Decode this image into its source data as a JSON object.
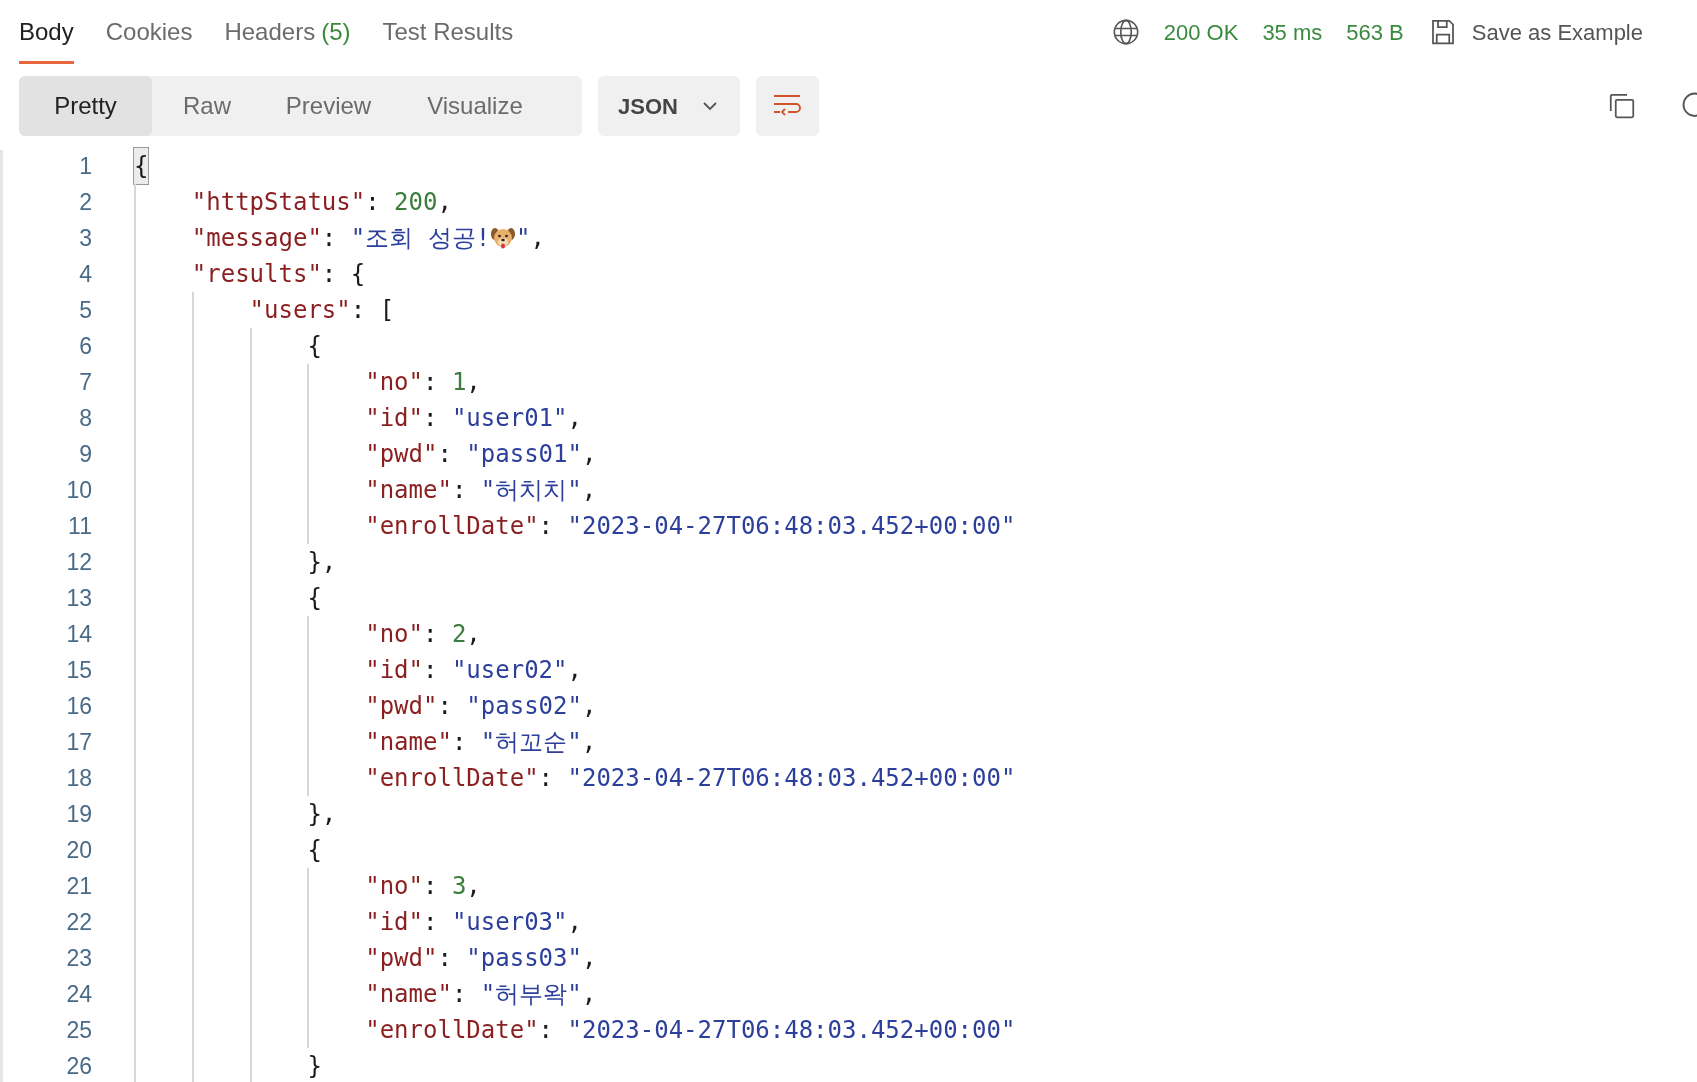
{
  "tabs": [
    {
      "label": "Body",
      "selected": true
    },
    {
      "label": "Cookies",
      "selected": false
    },
    {
      "label": "Headers",
      "count": "(5)",
      "selected": false
    },
    {
      "label": "Test Results",
      "selected": false
    }
  ],
  "response_meta": {
    "status": "200 OK",
    "time": "35 ms",
    "size": "563 B",
    "save_label": "Save as Example"
  },
  "view_modes": [
    {
      "label": "Pretty",
      "selected": true
    },
    {
      "label": "Raw",
      "selected": false
    },
    {
      "label": "Preview",
      "selected": false
    },
    {
      "label": "Visualize",
      "selected": false
    }
  ],
  "format_dropdown": {
    "value": "JSON"
  },
  "lines": [
    {
      "number": "1",
      "highlighted": true,
      "tokens": [
        {
          "kind": "punct",
          "text": "{"
        }
      ],
      "children": [
        {
          "number": "2",
          "highlighted": false,
          "tokens": [
            {
              "kind": "key",
              "text": "\"httpStatus\""
            },
            {
              "kind": "punct",
              "text": ": "
            },
            {
              "kind": "number",
              "text": "200"
            },
            {
              "kind": "punct",
              "text": ","
            }
          ]
        },
        {
          "number": "3",
          "highlighted": false,
          "tokens": [
            {
              "kind": "key",
              "text": "\"message\""
            },
            {
              "kind": "punct",
              "text": ": "
            },
            {
              "kind": "string",
              "text": "\"조회 성공!"
            },
            {
              "kind": "icon"
            },
            {
              "kind": "string",
              "text": "\""
            },
            {
              "kind": "punct",
              "text": ","
            }
          ]
        },
        {
          "number": "4",
          "highlighted": false,
          "tokens": [
            {
              "kind": "key",
              "text": "\"results\""
            },
            {
              "kind": "punct",
              "text": ": {"
            }
          ],
          "children": [
            {
              "number": "5",
              "highlighted": false,
              "tokens": [
                {
                  "kind": "key",
                  "text": "\"users\""
                },
                {
                  "kind": "punct",
                  "text": ": ["
                }
              ],
              "children": [
                {
                  "number": "6",
                  "highlighted": false,
                  "tokens": [
                    {
                      "kind": "punct",
                      "text": "{"
                    }
                  ],
                  "children": [
                    {
                      "number": "7",
                      "highlighted": false,
                      "tokens": [
                        {
                          "kind": "key",
                          "text": "\"no\""
                        },
                        {
                          "kind": "punct",
                          "text": ": "
                        },
                        {
                          "kind": "number",
                          "text": "1"
                        },
                        {
                          "kind": "punct",
                          "text": ","
                        }
                      ]
                    },
                    {
                      "number": "8",
                      "highlighted": false,
                      "tokens": [
                        {
                          "kind": "key",
                          "text": "\"id\""
                        },
                        {
                          "kind": "punct",
                          "text": ": "
                        },
                        {
                          "kind": "string",
                          "text": "\"user01\""
                        },
                        {
                          "kind": "punct",
                          "text": ","
                        }
                      ]
                    },
                    {
                      "number": "9",
                      "highlighted": false,
                      "tokens": [
                        {
                          "kind": "key",
                          "text": "\"pwd\""
                        },
                        {
                          "kind": "punct",
                          "text": ": "
                        },
                        {
                          "kind": "string",
                          "text": "\"pass01\""
                        },
                        {
                          "kind": "punct",
                          "text": ","
                        }
                      ]
                    },
                    {
                      "number": "10",
                      "highlighted": false,
                      "tokens": [
                        {
                          "kind": "key",
                          "text": "\"name\""
                        },
                        {
                          "kind": "punct",
                          "text": ": "
                        },
                        {
                          "kind": "string",
                          "text": "\"허치치\""
                        },
                        {
                          "kind": "punct",
                          "text": ","
                        }
                      ]
                    },
                    {
                      "number": "11",
                      "highlighted": false,
                      "tokens": [
                        {
                          "kind": "key",
                          "text": "\"enrollDate\""
                        },
                        {
                          "kind": "punct",
                          "text": ": "
                        },
                        {
                          "kind": "string",
                          "text": "\"2023-04-27T06:48:03.452+00:00\""
                        }
                      ]
                    }
                  ]
                },
                {
                  "number": "12",
                  "highlighted": false,
                  "tokens": [
                    {
                      "kind": "punct",
                      "text": "},"
                    }
                  ]
                },
                {
                  "number": "13",
                  "highlighted": false,
                  "tokens": [
                    {
                      "kind": "punct",
                      "text": "{"
                    }
                  ],
                  "children": [
                    {
                      "number": "14",
                      "highlighted": false,
                      "tokens": [
                        {
                          "kind": "key",
                          "text": "\"no\""
                        },
                        {
                          "kind": "punct",
                          "text": ": "
                        },
                        {
                          "kind": "number",
                          "text": "2"
                        },
                        {
                          "kind": "punct",
                          "text": ","
                        }
                      ]
                    },
                    {
                      "number": "15",
                      "highlighted": false,
                      "tokens": [
                        {
                          "kind": "key",
                          "text": "\"id\""
                        },
                        {
                          "kind": "punct",
                          "text": ": "
                        },
                        {
                          "kind": "string",
                          "text": "\"user02\""
                        },
                        {
                          "kind": "punct",
                          "text": ","
                        }
                      ]
                    },
                    {
                      "number": "16",
                      "highlighted": false,
                      "tokens": [
                        {
                          "kind": "key",
                          "text": "\"pwd\""
                        },
                        {
                          "kind": "punct",
                          "text": ": "
                        },
                        {
                          "kind": "string",
                          "text": "\"pass02\""
                        },
                        {
                          "kind": "punct",
                          "text": ","
                        }
                      ]
                    },
                    {
                      "number": "17",
                      "highlighted": false,
                      "tokens": [
                        {
                          "kind": "key",
                          "text": "\"name\""
                        },
                        {
                          "kind": "punct",
                          "text": ": "
                        },
                        {
                          "kind": "string",
                          "text": "\"허꼬순\""
                        },
                        {
                          "kind": "punct",
                          "text": ","
                        }
                      ]
                    },
                    {
                      "number": "18",
                      "highlighted": false,
                      "tokens": [
                        {
                          "kind": "key",
                          "text": "\"enrollDate\""
                        },
                        {
                          "kind": "punct",
                          "text": ": "
                        },
                        {
                          "kind": "string",
                          "text": "\"2023-04-27T06:48:03.452+00:00\""
                        }
                      ]
                    }
                  ]
                },
                {
                  "number": "19",
                  "highlighted": false,
                  "tokens": [
                    {
                      "kind": "punct",
                      "text": "},"
                    }
                  ]
                },
                {
                  "number": "20",
                  "highlighted": false,
                  "tokens": [
                    {
                      "kind": "punct",
                      "text": "{"
                    }
                  ],
                  "children": [
                    {
                      "number": "21",
                      "highlighted": false,
                      "tokens": [
                        {
                          "kind": "key",
                          "text": "\"no\""
                        },
                        {
                          "kind": "punct",
                          "text": ": "
                        },
                        {
                          "kind": "number",
                          "text": "3"
                        },
                        {
                          "kind": "punct",
                          "text": ","
                        }
                      ]
                    },
                    {
                      "number": "22",
                      "highlighted": false,
                      "tokens": [
                        {
                          "kind": "key",
                          "text": "\"id\""
                        },
                        {
                          "kind": "punct",
                          "text": ": "
                        },
                        {
                          "kind": "string",
                          "text": "\"user03\""
                        },
                        {
                          "kind": "punct",
                          "text": ","
                        }
                      ]
                    },
                    {
                      "number": "23",
                      "highlighted": false,
                      "tokens": [
                        {
                          "kind": "key",
                          "text": "\"pwd\""
                        },
                        {
                          "kind": "punct",
                          "text": ": "
                        },
                        {
                          "kind": "string",
                          "text": "\"pass03\""
                        },
                        {
                          "kind": "punct",
                          "text": ","
                        }
                      ]
                    },
                    {
                      "number": "24",
                      "highlighted": false,
                      "tokens": [
                        {
                          "kind": "key",
                          "text": "\"name\""
                        },
                        {
                          "kind": "punct",
                          "text": ": "
                        },
                        {
                          "kind": "string",
                          "text": "\"허부왁\""
                        },
                        {
                          "kind": "punct",
                          "text": ","
                        }
                      ]
                    },
                    {
                      "number": "25",
                      "highlighted": false,
                      "tokens": [
                        {
                          "kind": "key",
                          "text": "\"enrollDate\""
                        },
                        {
                          "kind": "punct",
                          "text": ": "
                        },
                        {
                          "kind": "string",
                          "text": "\"2023-04-27T06:48:03.452+00:00\""
                        }
                      ]
                    }
                  ]
                },
                {
                  "number": "26",
                  "highlighted": false,
                  "tokens": [
                    {
                      "kind": "punct",
                      "text": "}"
                    }
                  ]
                }
              ]
            }
          ]
        }
      ]
    }
  ]
}
